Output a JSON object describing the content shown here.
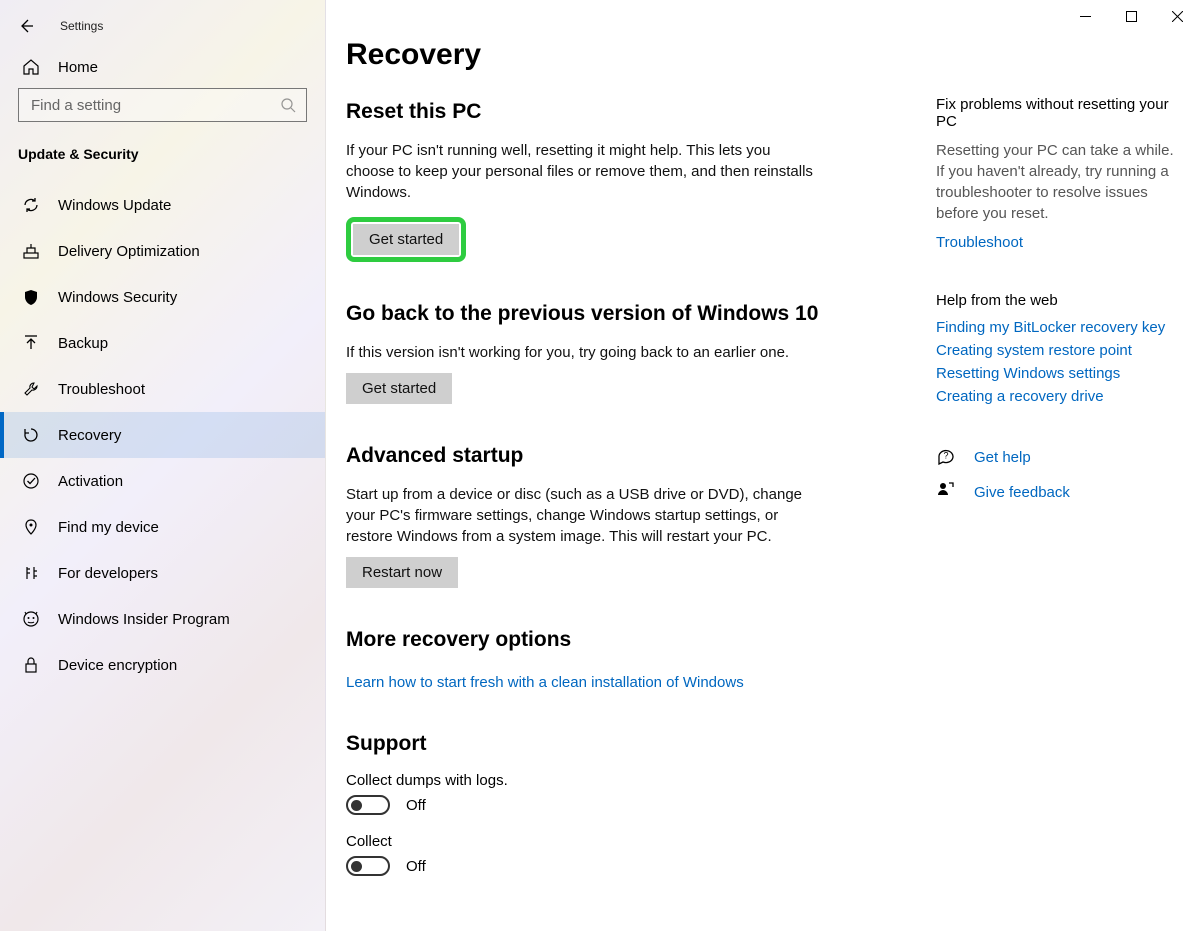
{
  "window": {
    "title": "Settings"
  },
  "sidebar": {
    "home": "Home",
    "search_placeholder": "Find a setting",
    "category": "Update & Security",
    "items": [
      {
        "label": "Windows Update"
      },
      {
        "label": "Delivery Optimization"
      },
      {
        "label": "Windows Security"
      },
      {
        "label": "Backup"
      },
      {
        "label": "Troubleshoot"
      },
      {
        "label": "Recovery",
        "active": true
      },
      {
        "label": "Activation"
      },
      {
        "label": "Find my device"
      },
      {
        "label": "For developers"
      },
      {
        "label": "Windows Insider Program"
      },
      {
        "label": "Device encryption"
      }
    ]
  },
  "main": {
    "title": "Recovery",
    "reset": {
      "heading": "Reset this PC",
      "desc": "If your PC isn't running well, resetting it might help. This lets you choose to keep your personal files or remove them, and then reinstalls Windows.",
      "button": "Get started"
    },
    "goback": {
      "heading": "Go back to the previous version of Windows 10",
      "desc": "If this version isn't working for you, try going back to an earlier one.",
      "button": "Get started"
    },
    "advanced": {
      "heading": "Advanced startup",
      "desc": "Start up from a device or disc (such as a USB drive or DVD), change your PC's firmware settings, change Windows startup settings, or restore Windows from a system image. This will restart your PC.",
      "button": "Restart now"
    },
    "more": {
      "heading": "More recovery options",
      "link": "Learn how to start fresh with a clean installation of Windows"
    },
    "support": {
      "heading": "Support",
      "opt1_label": "Collect dumps with logs.",
      "opt1_state": "Off",
      "opt2_label": "Collect",
      "opt2_state": "Off"
    }
  },
  "right": {
    "fix": {
      "heading": "Fix problems without resetting your PC",
      "desc": "Resetting your PC can take a while. If you haven't already, try running a troubleshooter to resolve issues before you reset.",
      "link": "Troubleshoot"
    },
    "web": {
      "heading": "Help from the web",
      "links": [
        "Finding my BitLocker recovery key",
        "Creating system restore point",
        "Resetting Windows settings",
        "Creating a recovery drive"
      ]
    },
    "help": {
      "get_help": "Get help",
      "feedback": "Give feedback"
    }
  }
}
